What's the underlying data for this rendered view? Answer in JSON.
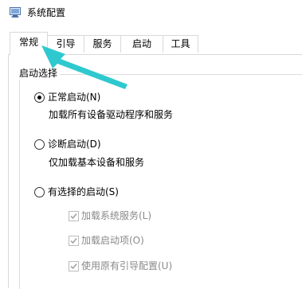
{
  "window": {
    "title": "系统配置",
    "icon": "system-config-icon"
  },
  "tabs": [
    {
      "label": "常规",
      "active": true
    },
    {
      "label": "引导",
      "active": false
    },
    {
      "label": "服务",
      "active": false
    },
    {
      "label": "启动",
      "active": false
    },
    {
      "label": "工具",
      "active": false
    }
  ],
  "startup_selection": {
    "group_label": "启动选择",
    "options": [
      {
        "label": "正常启动(N)",
        "description": "加载所有设备驱动程序和服务",
        "selected": true
      },
      {
        "label": "诊断启动(D)",
        "description": "仅加载基本设备和服务",
        "selected": false
      },
      {
        "label": "有选择的启动(S)",
        "description": "",
        "selected": false
      }
    ],
    "selective_items": [
      {
        "label": "加载系统服务(L)",
        "checked": true,
        "enabled": false
      },
      {
        "label": "加载启动项(O)",
        "checked": true,
        "enabled": false
      },
      {
        "label": "使用原有引导配置(U)",
        "checked": true,
        "enabled": false
      }
    ]
  },
  "annotation": {
    "arrow_color": "#2ec9cf"
  },
  "colors": {
    "border": "#d9d9d9",
    "disabled_text": "#8a8a8a"
  }
}
